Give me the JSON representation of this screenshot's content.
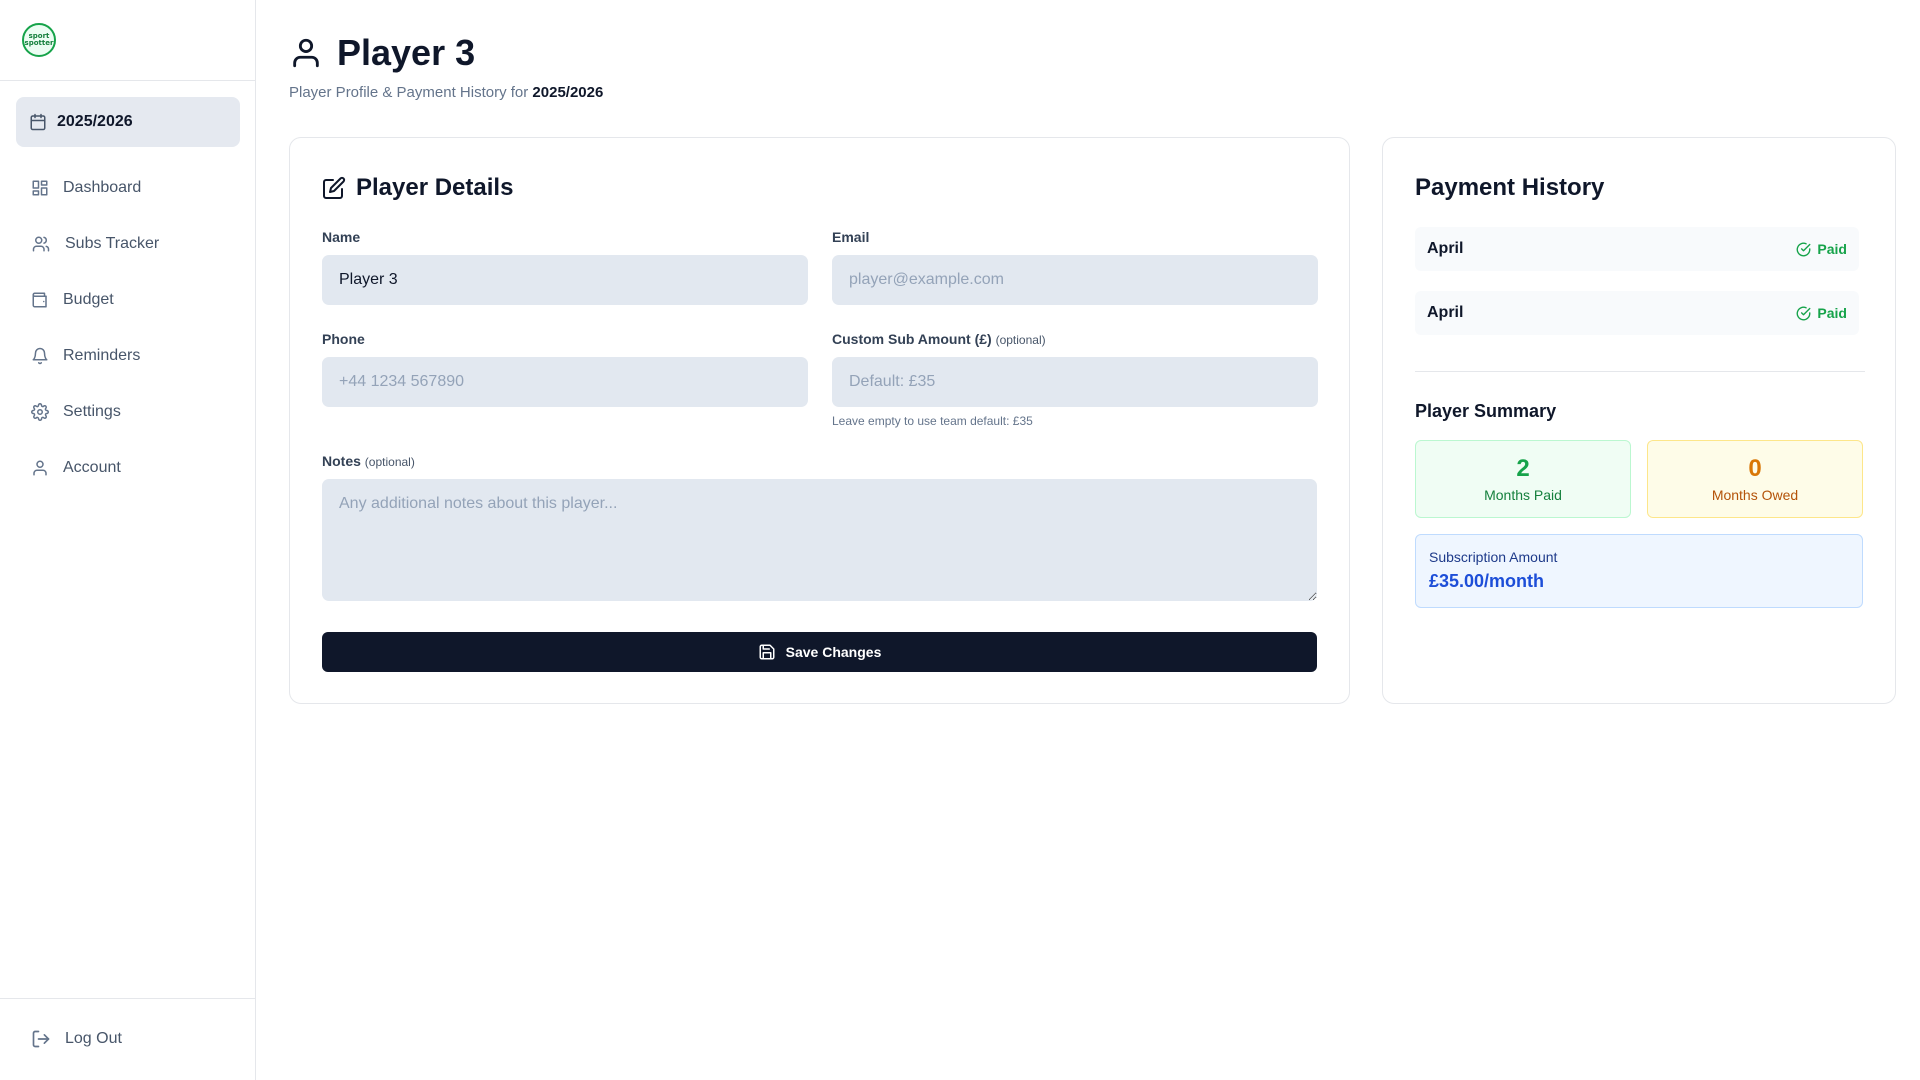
{
  "sidebar": {
    "logo": {
      "line1": "sport",
      "line2": "spotter"
    },
    "season": "2025/2026",
    "items": [
      {
        "label": "Dashboard",
        "icon": "dashboard-icon"
      },
      {
        "label": "Subs Tracker",
        "icon": "users-icon"
      },
      {
        "label": "Budget",
        "icon": "wallet-icon"
      },
      {
        "label": "Reminders",
        "icon": "bell-icon"
      },
      {
        "label": "Settings",
        "icon": "gear-icon"
      },
      {
        "label": "Account",
        "icon": "user-icon"
      }
    ],
    "logout": "Log Out"
  },
  "header": {
    "title": "Player 3",
    "subtitle_prefix": "Player Profile & Payment History for",
    "subtitle_season": "2025/2026"
  },
  "details": {
    "title": "Player Details",
    "name_label": "Name",
    "name_value": "Player 3",
    "email_label": "Email",
    "email_placeholder": "player@example.com",
    "phone_label": "Phone",
    "phone_placeholder": "+44 1234 567890",
    "sub_label": "Custom Sub Amount (£)",
    "sub_optional": "(optional)",
    "sub_placeholder": "Default: £35",
    "sub_hint": "Leave empty to use team default: £35",
    "notes_label": "Notes",
    "notes_optional": "(optional)",
    "notes_placeholder": "Any additional notes about this player...",
    "save_label": "Save Changes"
  },
  "payments": {
    "title": "Payment History",
    "rows": [
      {
        "month": "April",
        "status": "Paid"
      },
      {
        "month": "April",
        "status": "Paid"
      }
    ],
    "summary_title": "Player Summary",
    "months_paid": "2",
    "months_paid_label": "Months Paid",
    "months_owed": "0",
    "months_owed_label": "Months Owed",
    "subscription_label": "Subscription Amount",
    "subscription_value": "£35.00/month"
  },
  "colors": {
    "primary": "#0f172a",
    "paid": "#16a34a",
    "owed": "#d97706",
    "subscription": "#1d4ed8"
  }
}
